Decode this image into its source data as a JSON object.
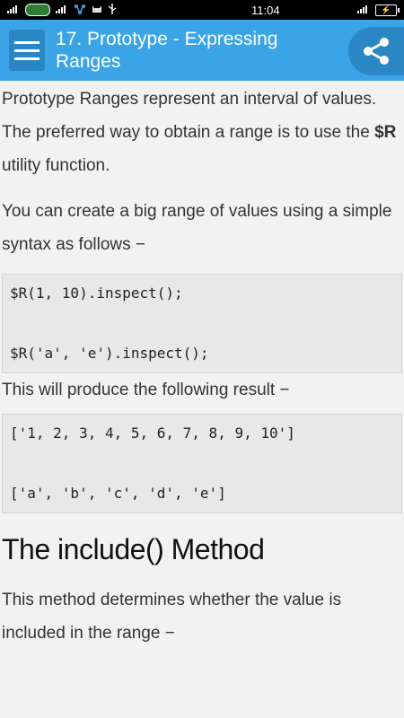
{
  "statusbar": {
    "time": "11:04",
    "battery_glyph": "⚡"
  },
  "appbar": {
    "title": "17. Prototype - Expressing Ranges"
  },
  "content": {
    "p1_before": "Prototype Ranges represent an interval of values. The preferred way to obtain a range is to use the ",
    "p1_bold": "$R",
    "p1_after": " utility function.",
    "p2": "You can create a big range of values using a simple syntax as follows −",
    "code1": [
      "$R(1, 10).inspect();",
      "$R('a', 'e').inspect();"
    ],
    "p3": "This will produce the following result −",
    "code2": [
      "['1, 2, 3, 4, 5, 6, 7, 8, 9, 10']",
      "['a', 'b', 'c', 'd', 'e']"
    ],
    "heading": "The include() Method",
    "p4": "This method determines whether the value is included in the range −"
  },
  "colors": {
    "appbar": "#3aa4e6",
    "appbar_button": "#2a87c4",
    "background": "#f2f2f2",
    "code_bg": "#e8e8e8"
  },
  "icons": {
    "menu": "hamburger-menu-icon",
    "share": "share-icon"
  }
}
